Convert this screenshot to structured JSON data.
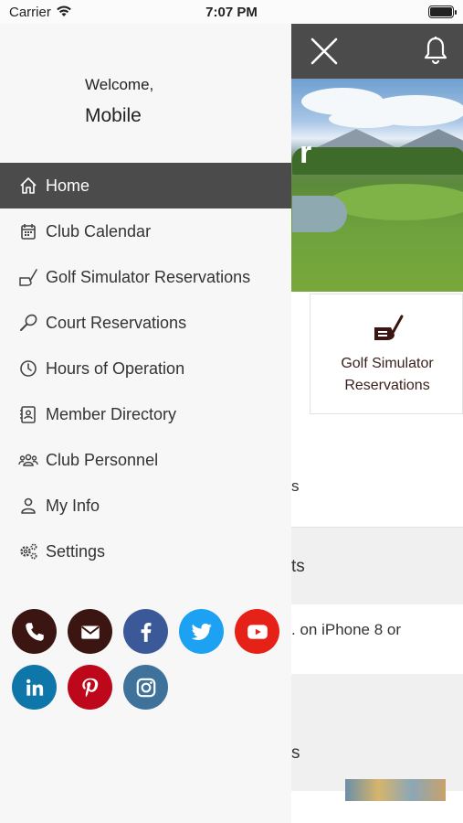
{
  "status_bar": {
    "carrier": "Carrier",
    "time": "7:07 PM"
  },
  "drawer": {
    "welcome": "Welcome,",
    "username": "Mobile",
    "menu": [
      {
        "label": "Home",
        "icon": "home-icon",
        "active": true
      },
      {
        "label": "Club Calendar",
        "icon": "calendar-icon",
        "active": false
      },
      {
        "label": "Golf Simulator Reservations",
        "icon": "golf-club-icon",
        "active": false
      },
      {
        "label": "Court Reservations",
        "icon": "racquet-icon",
        "active": false
      },
      {
        "label": "Hours of Operation",
        "icon": "clock-icon",
        "active": false
      },
      {
        "label": "Member Directory",
        "icon": "directory-icon",
        "active": false
      },
      {
        "label": "Club Personnel",
        "icon": "people-icon",
        "active": false
      },
      {
        "label": "My Info",
        "icon": "person-icon",
        "active": false
      },
      {
        "label": "Settings",
        "icon": "gear-icon",
        "active": false
      }
    ],
    "social": [
      {
        "name": "phone-icon",
        "color": "#3b1512"
      },
      {
        "name": "email-icon",
        "color": "#3b1512"
      },
      {
        "name": "facebook-icon",
        "color": "#3b5998"
      },
      {
        "name": "twitter-icon",
        "color": "#1da1f2"
      },
      {
        "name": "youtube-icon",
        "color": "#e62117"
      },
      {
        "name": "linkedin-icon",
        "color": "#0e76a8"
      },
      {
        "name": "pinterest-icon",
        "color": "#bd081c"
      },
      {
        "name": "instagram-icon",
        "color": "#3f729b"
      }
    ]
  },
  "main": {
    "hero_overlay_text": "r",
    "tile_gsr_label": "Golf Simulator Reservations",
    "peek_text_1": "s",
    "peek_text_2": "ts",
    "peek_text_3": ". on iPhone 8 or",
    "peek_text_4": "s"
  },
  "colors": {
    "topbar": "#4b4b4b",
    "drawer_bg": "#f7f7f7",
    "active_item": "#4b4b4b",
    "brand_dark": "#3b1512"
  }
}
